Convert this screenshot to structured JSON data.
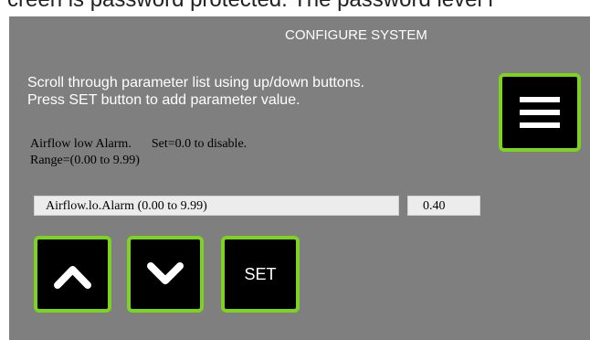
{
  "top_caption": "creen is password protected. The password level i",
  "screen": {
    "title": "CONFIGURE SYSTEM",
    "instructions": [
      "Scroll through parameter list using up/down buttons.",
      "Press SET button to add parameter value."
    ],
    "description": {
      "name": "Airflow low Alarm.",
      "set_hint": "Set=0.0 to disable.",
      "range": "Range=(0.00 to 9.99)"
    },
    "parameter": {
      "label": "Airflow.lo.Alarm   (0.00 to 9.99)",
      "value": "0.40"
    },
    "buttons": {
      "menu_icon": "hamburger-menu-icon",
      "up_icon": "chevron-up-icon",
      "down_icon": "chevron-down-icon",
      "set_label": "SET"
    }
  },
  "colors": {
    "panel_background": "#7f7f7f",
    "button_fill": "#000000",
    "button_border": "#7ed321",
    "field_background": "#ececec",
    "text_light": "#ffffff"
  }
}
